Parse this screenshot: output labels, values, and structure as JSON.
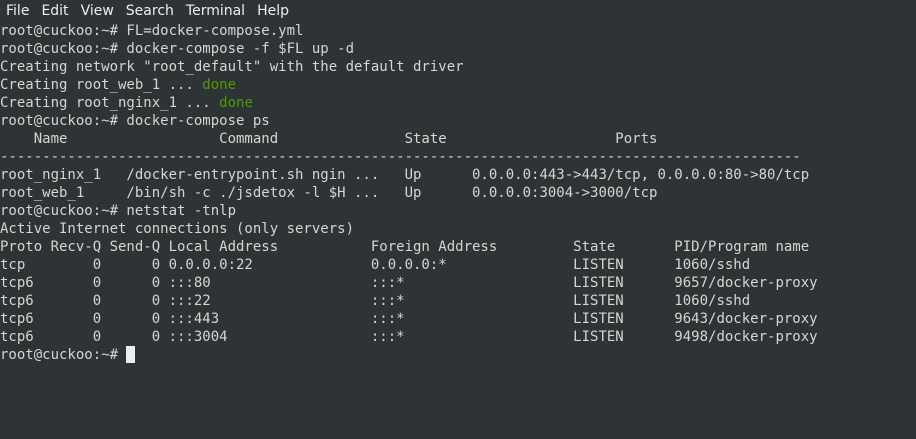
{
  "menu": {
    "file": "File",
    "edit": "Edit",
    "view": "View",
    "search": "Search",
    "terminal": "Terminal",
    "help": "Help"
  },
  "colors": {
    "background": "#2e3436",
    "foreground": "#d3d7cf",
    "done_green": "#4e9a06",
    "cursor": "#eeeeec"
  },
  "terminal": {
    "lines": [
      {
        "text": "root@cuckoo:~# FL=docker-compose.yml"
      },
      {
        "text": "root@cuckoo:~# docker-compose -f $FL up -d"
      },
      {
        "text": "Creating network \"root_default\" with the default driver"
      },
      {
        "text": "Creating root_web_1 ... ",
        "status": "done"
      },
      {
        "text": "Creating root_nginx_1 ... ",
        "status": "done"
      },
      {
        "text": "root@cuckoo:~# docker-compose ps"
      },
      {
        "text": "    Name                  Command               State                    Ports"
      },
      {
        "text": "-----------------------------------------------------------------------------------------------"
      },
      {
        "text": "root_nginx_1   /docker-entrypoint.sh ngin ...   Up      0.0.0.0:443->443/tcp, 0.0.0.0:80->80/tcp"
      },
      {
        "text": "root_web_1     /bin/sh -c ./jsdetox -l $H ...   Up      0.0.0.0:3004->3000/tcp"
      },
      {
        "text": "root@cuckoo:~# netstat -tnlp"
      },
      {
        "text": "Active Internet connections (only servers)"
      },
      {
        "text": "Proto Recv-Q Send-Q Local Address           Foreign Address         State       PID/Program name"
      },
      {
        "text": "tcp        0      0 0.0.0.0:22              0.0.0.0:*               LISTEN      1060/sshd"
      },
      {
        "text": "tcp6       0      0 :::80                   :::*                    LISTEN      9657/docker-proxy"
      },
      {
        "text": "tcp6       0      0 :::22                   :::*                    LISTEN      1060/sshd"
      },
      {
        "text": "tcp6       0      0 :::443                  :::*                    LISTEN      9643/docker-proxy"
      },
      {
        "text": "tcp6       0      0 :::3004                 :::*                    LISTEN      9498/docker-proxy"
      },
      {
        "text": "root@cuckoo:~# ",
        "cursor": true
      }
    ]
  }
}
